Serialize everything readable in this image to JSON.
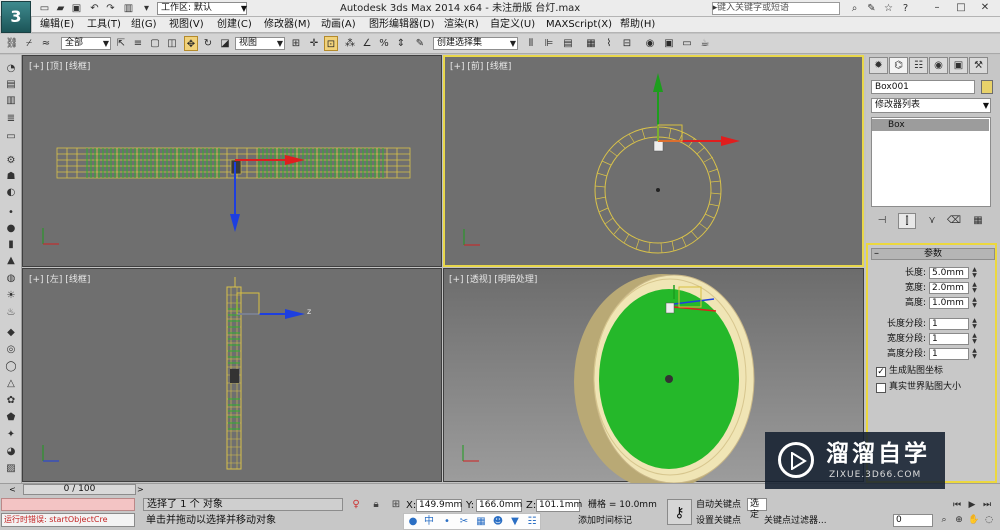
{
  "title_bar": {
    "logo": "3",
    "workspace_label": "工作区: 默认",
    "app_title": "Autodesk 3ds Max  2014 x64  -  未注册版     台灯.max",
    "search_placeholder": "键入关键字或短语"
  },
  "menu": [
    "编辑(E)",
    "工具(T)",
    "组(G)",
    "视图(V)",
    "创建(C)",
    "修改器(M)",
    "动画(A)",
    "图形编辑器(D)",
    "渲染(R)",
    "自定义(U)",
    "MAXScript(X)",
    "帮助(H)"
  ],
  "toolbar": {
    "selection_filter": "全部",
    "reference_coord": "视图",
    "named_selection": "创建选择集"
  },
  "viewports": {
    "top": {
      "label": "[+] [顶] [线框]"
    },
    "front": {
      "label": "[+] [前] [线框]"
    },
    "left": {
      "label": "[+] [左] [线框]"
    },
    "perspective": {
      "label": "[+] [透视] [明暗处理]"
    }
  },
  "command_panel": {
    "object_name": "Box001",
    "modifier_list": "修改器列表",
    "stack_item": "Box",
    "rollout_title": "参数",
    "params": [
      {
        "label": "长度:",
        "value": "5.0mm"
      },
      {
        "label": "宽度:",
        "value": "2.0mm"
      },
      {
        "label": "高度:",
        "value": "1.0mm"
      }
    ],
    "segs": [
      {
        "label": "长度分段:",
        "value": "1"
      },
      {
        "label": "宽度分段:",
        "value": "1"
      },
      {
        "label": "高度分段:",
        "value": "1"
      }
    ],
    "check_gen_uv": {
      "label": "生成贴图坐标",
      "checked": true
    },
    "check_real_world": {
      "label": "真实世界贴图大小",
      "checked": false
    }
  },
  "status": {
    "time_slider": "0 / 100",
    "script_error": "运行时错误: startObjectCre",
    "selected_count": "选择了 1 个 对象",
    "prompt": "单击并拖动以选择并移动对象",
    "x_label": "X:",
    "x_value": "149.9mm",
    "y_label": "Y:",
    "y_value": "166.0mm",
    "z_label": "Z:",
    "z_value": "101.1mm",
    "grid": "栅格 = 10.0mm",
    "add_time_tag": "添加时间标记",
    "auto_key": "自动关键点",
    "set_key": "设置关键点",
    "selection_set": "选定",
    "key_filters": "关键点过滤器...",
    "frame": "0"
  },
  "ime": {
    "lang": "中"
  },
  "watermark": {
    "brand": "溜溜自学",
    "url": "ZIXUE.3D66.COM"
  },
  "colors": {
    "accent": "#ecd83e",
    "viewport_bg": "#6f6f6f",
    "wireframe": "#e0c850",
    "green_face": "#28b428"
  }
}
